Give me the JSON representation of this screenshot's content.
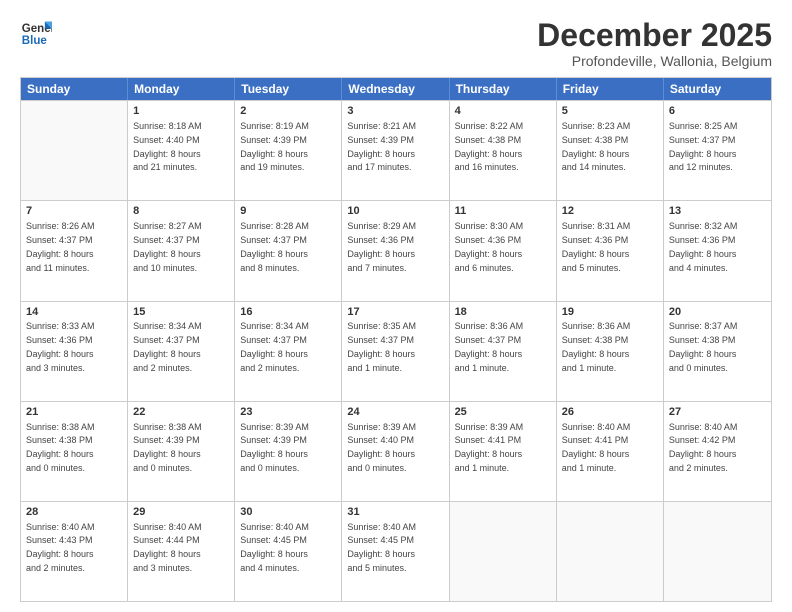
{
  "logo": {
    "line1": "General",
    "line2": "Blue"
  },
  "title": "December 2025",
  "location": "Profondeville, Wallonia, Belgium",
  "header_days": [
    "Sunday",
    "Monday",
    "Tuesday",
    "Wednesday",
    "Thursday",
    "Friday",
    "Saturday"
  ],
  "weeks": [
    [
      {
        "day": "",
        "info": ""
      },
      {
        "day": "1",
        "info": "Sunrise: 8:18 AM\nSunset: 4:40 PM\nDaylight: 8 hours\nand 21 minutes."
      },
      {
        "day": "2",
        "info": "Sunrise: 8:19 AM\nSunset: 4:39 PM\nDaylight: 8 hours\nand 19 minutes."
      },
      {
        "day": "3",
        "info": "Sunrise: 8:21 AM\nSunset: 4:39 PM\nDaylight: 8 hours\nand 17 minutes."
      },
      {
        "day": "4",
        "info": "Sunrise: 8:22 AM\nSunset: 4:38 PM\nDaylight: 8 hours\nand 16 minutes."
      },
      {
        "day": "5",
        "info": "Sunrise: 8:23 AM\nSunset: 4:38 PM\nDaylight: 8 hours\nand 14 minutes."
      },
      {
        "day": "6",
        "info": "Sunrise: 8:25 AM\nSunset: 4:37 PM\nDaylight: 8 hours\nand 12 minutes."
      }
    ],
    [
      {
        "day": "7",
        "info": "Sunrise: 8:26 AM\nSunset: 4:37 PM\nDaylight: 8 hours\nand 11 minutes."
      },
      {
        "day": "8",
        "info": "Sunrise: 8:27 AM\nSunset: 4:37 PM\nDaylight: 8 hours\nand 10 minutes."
      },
      {
        "day": "9",
        "info": "Sunrise: 8:28 AM\nSunset: 4:37 PM\nDaylight: 8 hours\nand 8 minutes."
      },
      {
        "day": "10",
        "info": "Sunrise: 8:29 AM\nSunset: 4:36 PM\nDaylight: 8 hours\nand 7 minutes."
      },
      {
        "day": "11",
        "info": "Sunrise: 8:30 AM\nSunset: 4:36 PM\nDaylight: 8 hours\nand 6 minutes."
      },
      {
        "day": "12",
        "info": "Sunrise: 8:31 AM\nSunset: 4:36 PM\nDaylight: 8 hours\nand 5 minutes."
      },
      {
        "day": "13",
        "info": "Sunrise: 8:32 AM\nSunset: 4:36 PM\nDaylight: 8 hours\nand 4 minutes."
      }
    ],
    [
      {
        "day": "14",
        "info": "Sunrise: 8:33 AM\nSunset: 4:36 PM\nDaylight: 8 hours\nand 3 minutes."
      },
      {
        "day": "15",
        "info": "Sunrise: 8:34 AM\nSunset: 4:37 PM\nDaylight: 8 hours\nand 2 minutes."
      },
      {
        "day": "16",
        "info": "Sunrise: 8:34 AM\nSunset: 4:37 PM\nDaylight: 8 hours\nand 2 minutes."
      },
      {
        "day": "17",
        "info": "Sunrise: 8:35 AM\nSunset: 4:37 PM\nDaylight: 8 hours\nand 1 minute."
      },
      {
        "day": "18",
        "info": "Sunrise: 8:36 AM\nSunset: 4:37 PM\nDaylight: 8 hours\nand 1 minute."
      },
      {
        "day": "19",
        "info": "Sunrise: 8:36 AM\nSunset: 4:38 PM\nDaylight: 8 hours\nand 1 minute."
      },
      {
        "day": "20",
        "info": "Sunrise: 8:37 AM\nSunset: 4:38 PM\nDaylight: 8 hours\nand 0 minutes."
      }
    ],
    [
      {
        "day": "21",
        "info": "Sunrise: 8:38 AM\nSunset: 4:38 PM\nDaylight: 8 hours\nand 0 minutes."
      },
      {
        "day": "22",
        "info": "Sunrise: 8:38 AM\nSunset: 4:39 PM\nDaylight: 8 hours\nand 0 minutes."
      },
      {
        "day": "23",
        "info": "Sunrise: 8:39 AM\nSunset: 4:39 PM\nDaylight: 8 hours\nand 0 minutes."
      },
      {
        "day": "24",
        "info": "Sunrise: 8:39 AM\nSunset: 4:40 PM\nDaylight: 8 hours\nand 0 minutes."
      },
      {
        "day": "25",
        "info": "Sunrise: 8:39 AM\nSunset: 4:41 PM\nDaylight: 8 hours\nand 1 minute."
      },
      {
        "day": "26",
        "info": "Sunrise: 8:40 AM\nSunset: 4:41 PM\nDaylight: 8 hours\nand 1 minute."
      },
      {
        "day": "27",
        "info": "Sunrise: 8:40 AM\nSunset: 4:42 PM\nDaylight: 8 hours\nand 2 minutes."
      }
    ],
    [
      {
        "day": "28",
        "info": "Sunrise: 8:40 AM\nSunset: 4:43 PM\nDaylight: 8 hours\nand 2 minutes."
      },
      {
        "day": "29",
        "info": "Sunrise: 8:40 AM\nSunset: 4:44 PM\nDaylight: 8 hours\nand 3 minutes."
      },
      {
        "day": "30",
        "info": "Sunrise: 8:40 AM\nSunset: 4:45 PM\nDaylight: 8 hours\nand 4 minutes."
      },
      {
        "day": "31",
        "info": "Sunrise: 8:40 AM\nSunset: 4:45 PM\nDaylight: 8 hours\nand 5 minutes."
      },
      {
        "day": "",
        "info": ""
      },
      {
        "day": "",
        "info": ""
      },
      {
        "day": "",
        "info": ""
      }
    ]
  ]
}
